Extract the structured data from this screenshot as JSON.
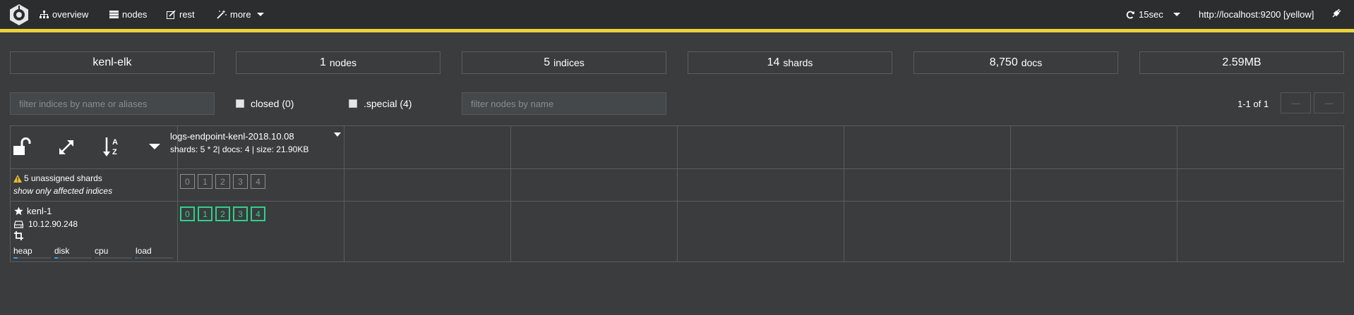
{
  "navbar": {
    "overview": "overview",
    "nodes": "nodes",
    "rest": "rest",
    "more": "more",
    "refresh": "15sec",
    "cluster_url": "http://localhost:9200 [yellow]"
  },
  "stats": {
    "cluster_name": "kenl-elk",
    "nodes_count": "1",
    "nodes_label": "nodes",
    "indices_count": "5",
    "indices_label": "indices",
    "shards_count": "14",
    "shards_label": "shards",
    "docs_count": "8,750",
    "docs_label": "docs",
    "size": "2.59MB"
  },
  "filters": {
    "indices_placeholder": "filter indices by name or aliases",
    "closed_label": "closed (0)",
    "special_label": ".special (4)",
    "nodes_placeholder": "filter nodes by name",
    "pager_text": "1-1 of 1"
  },
  "index": {
    "name": "logs-endpoint-kenl-2018.10.08",
    "meta": "shards: 5 * 2| docs: 4 | size: 21.90KB"
  },
  "unassigned": {
    "text": "5 unassigned shards",
    "link": "show only affected indices",
    "shards": [
      "0",
      "1",
      "2",
      "3",
      "4"
    ]
  },
  "node": {
    "name": "kenl-1",
    "ip": "10.12.90.248",
    "shards": [
      "0",
      "1",
      "2",
      "3",
      "4"
    ],
    "metrics": {
      "heap": "heap",
      "disk": "disk",
      "cpu": "cpu",
      "load": "load"
    },
    "metric_levels": {
      "heap": 0.12,
      "disk": 0.1,
      "cpu": 0.0,
      "load": 0.02
    }
  },
  "colors": {
    "status_stripe": "#e8d33a",
    "started_shard": "#2fd08d",
    "metric_fill": "#3f9be0"
  }
}
